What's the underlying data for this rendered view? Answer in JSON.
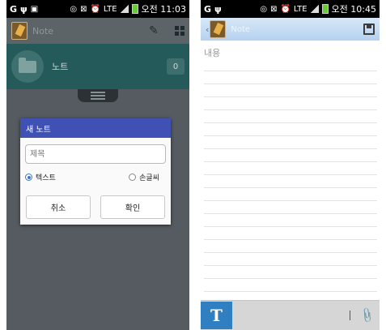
{
  "left_screen": {
    "status_bar": {
      "carrier_glyph": "G",
      "usb_glyph": "ψ",
      "network": "LTE",
      "ampm": "오전",
      "time": "11:03"
    },
    "app_bar": {
      "title": "Note"
    },
    "folder": {
      "label": "노트",
      "count": "0"
    },
    "dialog": {
      "title": "새 노트",
      "title_placeholder": "제목",
      "radio_text_label": "텍스트",
      "radio_handwriting_label": "손글씨",
      "selected": "텍스트",
      "cancel_label": "취소",
      "ok_label": "확인"
    }
  },
  "right_screen": {
    "status_bar": {
      "carrier_glyph": "G",
      "usb_glyph": "ψ",
      "network": "LTE",
      "ampm": "오전",
      "time": "10:45"
    },
    "app_bar": {
      "title": "Note"
    },
    "content_placeholder": "내용",
    "toolbar": {
      "text_button": "T"
    }
  },
  "colors": {
    "dialog_header": "#3f51b5",
    "folder_row": "#245a5a",
    "right_appbar": "#b5d1ef",
    "text_button": "#2f7fc1"
  }
}
